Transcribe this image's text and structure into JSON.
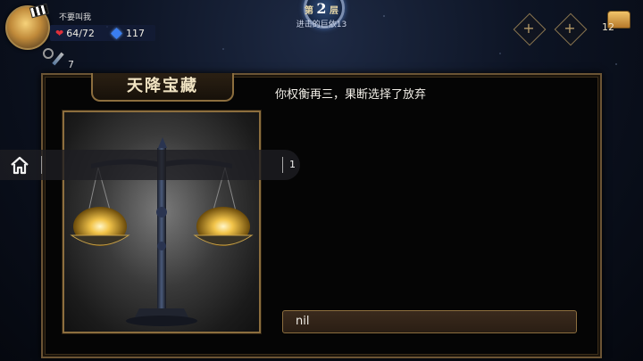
{
  "player": {
    "name": "不要叫我",
    "hp": "64/72",
    "mana": "117",
    "item_count": "7"
  },
  "floor": {
    "prefix": "第",
    "number": "2",
    "suffix": "层",
    "subtitle": "进击的巨依13"
  },
  "top_right": {
    "chest_count": "12"
  },
  "event": {
    "title": "天降宝藏",
    "narration": "你权衡再三，果断选择了放弃",
    "result": "nil"
  },
  "overlay": {
    "tab_count": "1"
  },
  "colors": {
    "panel_border": "#6b5434",
    "gold_accent": "#8c6e3e",
    "hp_red": "#e0303a",
    "mana_blue": "#3a7ef0"
  },
  "icons": [
    "heart-icon",
    "mana-crystal-icon",
    "dagger-icon",
    "plus-icon",
    "treasure-chest-icon",
    "home-icon",
    "balance-scale-icon"
  ]
}
